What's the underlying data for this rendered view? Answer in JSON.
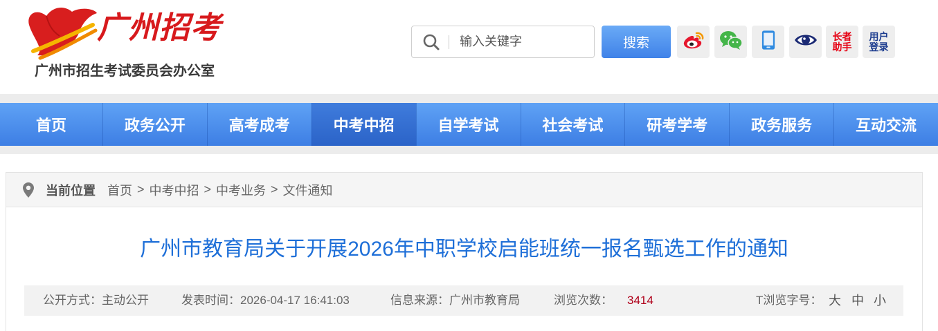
{
  "header": {
    "logo": {
      "title": "广州招考",
      "subtitle": "广州市招生考试委员会办公室",
      "icon": "tulip-logo-icon"
    },
    "search": {
      "icon": "search-icon",
      "placeholder": "输入关键字",
      "value": "",
      "button_label": "搜索"
    },
    "tools": {
      "weibo": {
        "icon": "weibo-icon"
      },
      "wechat": {
        "icon": "wechat-icon"
      },
      "mobile": {
        "icon": "mobile-icon"
      },
      "accessibility": {
        "icon": "eye-icon"
      },
      "elder_assist": {
        "line1": "长者",
        "line2": "助手"
      },
      "user_login": {
        "line1": "用户",
        "line2": "登录"
      }
    }
  },
  "nav": {
    "items": [
      {
        "label": "首页"
      },
      {
        "label": "政务公开"
      },
      {
        "label": "高考成考"
      },
      {
        "label": "中考中招",
        "active": true
      },
      {
        "label": "自学考试"
      },
      {
        "label": "社会考试"
      },
      {
        "label": "研考学考"
      },
      {
        "label": "政务服务"
      },
      {
        "label": "互动交流"
      }
    ]
  },
  "breadcrumb": {
    "icon": "location-pin-icon",
    "label": "当前位置",
    "separator": ">",
    "items": [
      "首页",
      "中考中招",
      "中考业务",
      "文件通知"
    ]
  },
  "article": {
    "title": "广州市教育局关于开展2026年中职学校启能班统一报名甄选工作的通知",
    "meta": {
      "disclosure": {
        "label": "公开方式：",
        "value": "主动公开"
      },
      "published": {
        "label": "发表时间：",
        "value": "2026-04-17 16:41:03"
      },
      "source": {
        "label": "信息来源：",
        "value": "广州市教育局"
      },
      "views": {
        "label": "浏览次数：",
        "value": "3414"
      },
      "font_size": {
        "label": "T浏览字号：",
        "options": [
          "大",
          "中",
          "小"
        ]
      }
    }
  },
  "colors": {
    "brand_red": "#d7191c",
    "nav_blue": "#4a8cec",
    "nav_active": "#2f69cc",
    "title_blue": "#1e6fd8",
    "view_count_red": "#b0001a",
    "search_button_blue": "#4d8ff0"
  }
}
